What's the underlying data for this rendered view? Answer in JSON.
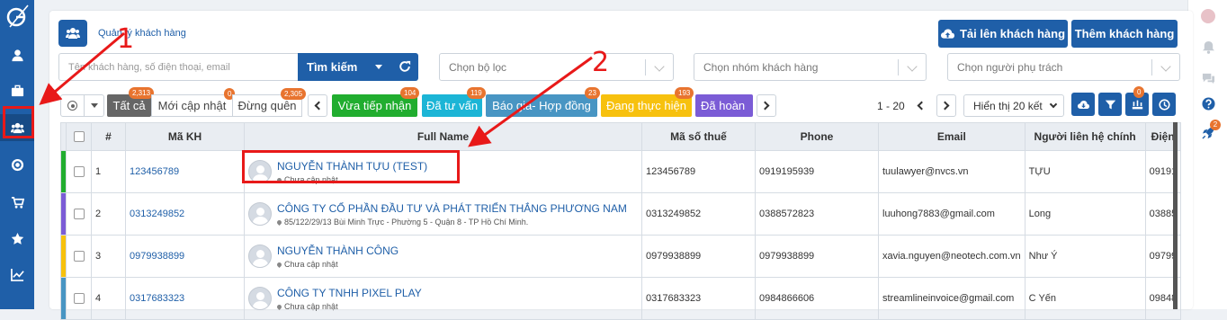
{
  "header": {
    "title": "Quản lý khách hàng",
    "upload_button": "Tải lên khách hàng",
    "add_button": "Thêm khách hàng"
  },
  "search": {
    "placeholder": "Tên khách hàng, số điện thoại, email",
    "button": "Tìm kiếm"
  },
  "filters": {
    "filter": "Chọn bộ lọc",
    "group": "Chọn nhóm khách hàng",
    "owner": "Chọn người phụ trách"
  },
  "tabs": [
    {
      "label": "Tất cả",
      "count": "2,313",
      "color": "#666666"
    },
    {
      "label": "Mới cập nhật",
      "count": "0",
      "color": ""
    },
    {
      "label": "Đừng quên",
      "count": "2,305",
      "color": ""
    },
    {
      "label": "Vừa tiếp nhận",
      "count": "104",
      "color": "#21ad2f"
    },
    {
      "label": "Đã tư vấn",
      "count": "119",
      "color": "#1cb5d6"
    },
    {
      "label": "Báo giá- Hợp đồng",
      "count": "23",
      "color": "#4895c3"
    },
    {
      "label": "Đang thực hiện",
      "count": "193",
      "color": "#f7c10e"
    },
    {
      "label": "Đã hoàn",
      "count": "",
      "color": "#7b5cd6"
    }
  ],
  "pager": {
    "range": "1 - 20",
    "per_page": "Hiển thị 20 kết",
    "filter_badge": "0"
  },
  "table": {
    "headers": [
      "#",
      "Mã KH",
      "Full Name",
      "Mã số thuế",
      "Phone",
      "Email",
      "Người liên hệ chính",
      "Điện"
    ],
    "rows": [
      {
        "flag": "#21ad2f",
        "num": "1",
        "code": "123456789",
        "name": "NGUYỄN THÀNH TỰU (TEST)",
        "address": "Chưa cập nhật",
        "tax": "123456789",
        "phone": "0919195939",
        "email": "tuulawyer@nvcs.vn",
        "contact": "TỰU",
        "extra": "09191"
      },
      {
        "flag": "#7b5cd6",
        "num": "2",
        "code": "0313249852",
        "name": "CÔNG TY CỔ PHẦN ĐẦU TƯ VÀ PHÁT TRIỂN THẮNG PHƯƠNG NAM",
        "address": "85/122/29/13 Bùi Minh Trực - Phường 5 - Quận 8 - TP Hồ Chí Minh.",
        "tax": "0313249852",
        "phone": "0388572823",
        "email": "luuhong7883@gmail.com",
        "contact": "Long",
        "extra": "03885"
      },
      {
        "flag": "#f7c10e",
        "num": "3",
        "code": "0979938899",
        "name": "NGUYỄN THÀNH CÔNG",
        "address": "Chưa cập nhật",
        "tax": "0979938899",
        "phone": "0979938899",
        "email": "xavia.nguyen@neotech.com.vn",
        "contact": "Như Ý",
        "extra": "09799"
      },
      {
        "flag": "#4895c3",
        "num": "4",
        "code": "0317683323",
        "name": "CÔNG TY TNHH PIXEL PLAY",
        "address": "Chưa cập nhật",
        "tax": "0317683323",
        "phone": "0984866606",
        "email": "streamlineinvoice@gmail.com",
        "contact": "C Yến",
        "extra": "09848"
      }
    ]
  },
  "annotations": [
    "1",
    "2"
  ],
  "rightbar": {
    "rocket_badge": "2"
  }
}
